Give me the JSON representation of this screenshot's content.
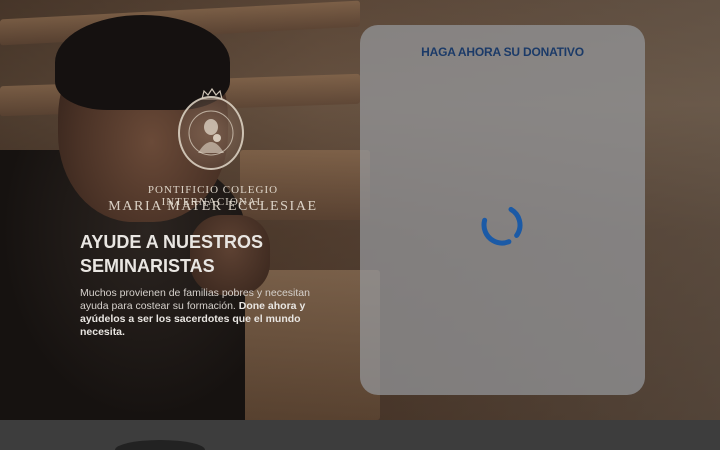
{
  "institute": {
    "line1": "PONTIFICIO COLEGIO INTERNACIONAL",
    "line2": "MARIA MATER ECCLESIAE",
    "seal_icon": "marian-seal-icon"
  },
  "hero": {
    "headline_line1": "AYUDE A NUESTROS",
    "headline_line2": "SEMINARISTAS",
    "lead_plain": "Muchos provienen de familias pobres y necesitan ayuda para costear su formación.",
    "lead_bold": "Done ahora y ayúdelos a ser los sacerdotes que el mundo necesita."
  },
  "donation": {
    "title": "HAGA AHORA SU DONATIVO",
    "spinner_icon": "loading-spinner-icon"
  },
  "colors": {
    "accent": "#1b5aa6",
    "title": "#1b3a68"
  }
}
